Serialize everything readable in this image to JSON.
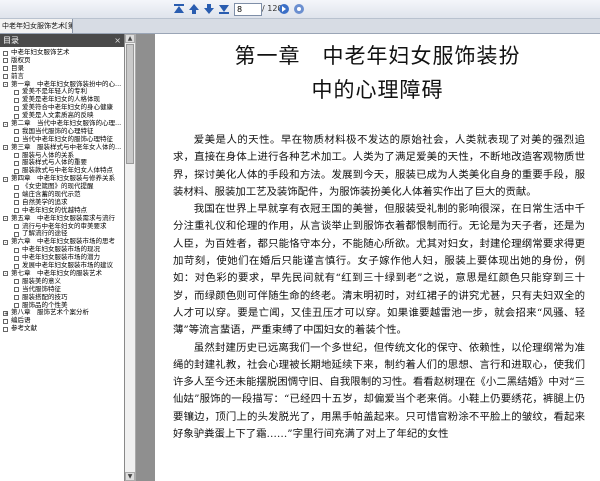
{
  "toolbar": {
    "page_number": "8",
    "page_total": "/ 120"
  },
  "tab": {
    "label": "中老年妇女服饰艺术[第一..."
  },
  "sidebar": {
    "header": "目录",
    "close": "×",
    "items": [
      {
        "label": "中老年妇女服饰艺术",
        "indent": 0
      },
      {
        "label": "版权页",
        "indent": 0
      },
      {
        "label": "目录",
        "indent": 0
      },
      {
        "label": "前言",
        "indent": 0
      },
      {
        "label": "第一章　中老年妇女服饰装扮中的心...",
        "indent": 0,
        "expand": "-"
      },
      {
        "label": "爱美不是年轻人的专利",
        "indent": 1
      },
      {
        "label": "爱美是老年妇女的人格体现",
        "indent": 1
      },
      {
        "label": "爱美符合中老年妇女的身心健康",
        "indent": 1
      },
      {
        "label": "爱美是人文素质高的反映",
        "indent": 1
      },
      {
        "label": "第二章　当代中老年妇女服饰的心理...",
        "indent": 0,
        "expand": "-"
      },
      {
        "label": "我国当代服饰的心理特征",
        "indent": 1
      },
      {
        "label": "当代中老年妇女的服饰心理特征",
        "indent": 1
      },
      {
        "label": "第三章　服装样式与中老年女人体的...",
        "indent": 0,
        "expand": "-"
      },
      {
        "label": "服装与人体的关系",
        "indent": 1
      },
      {
        "label": "服装样式与人体的重要",
        "indent": 1
      },
      {
        "label": "服装款式与中老年妇女人体特点",
        "indent": 1
      },
      {
        "label": "第四章　中老年妇女服装与修养关系",
        "indent": 0,
        "expand": "-"
      },
      {
        "label": "《女史箴图》的现代提醒",
        "indent": 1
      },
      {
        "label": "端庄含蓄的现代示范",
        "indent": 1
      },
      {
        "label": "自然美学的追求",
        "indent": 1
      },
      {
        "label": "中老年妇女的优越特点",
        "indent": 1
      },
      {
        "label": "第五章　中老年妇女服装需求与流行",
        "indent": 0,
        "expand": "-"
      },
      {
        "label": "流行与中老年妇女的审美要求",
        "indent": 1
      },
      {
        "label": "了解流行的途径",
        "indent": 1
      },
      {
        "label": "第六章　中老年妇女服装市场的思考",
        "indent": 0,
        "expand": "-"
      },
      {
        "label": "中老年妇女服装市场的现况",
        "indent": 1
      },
      {
        "label": "中老年妇女服装市场的潜力",
        "indent": 1
      },
      {
        "label": "发展中老年妇女服装市场的建议",
        "indent": 1
      },
      {
        "label": "第七章　中老年妇女的服装艺术",
        "indent": 0,
        "expand": "-"
      },
      {
        "label": "服装美的意义",
        "indent": 1
      },
      {
        "label": "当代服饰特征",
        "indent": 1
      },
      {
        "label": "服装搭配的技巧",
        "indent": 1
      },
      {
        "label": "服饰品的个性美",
        "indent": 1
      },
      {
        "label": "第八章　服饰艺术个案分析",
        "indent": 0,
        "expand": "+"
      },
      {
        "label": "编后语",
        "indent": 0
      },
      {
        "label": "参考文献",
        "indent": 0
      }
    ]
  },
  "document": {
    "title_line1": "第一章　中老年妇女服饰装扮",
    "title_line2": "中的心理障碍",
    "paragraphs": [
      "爱美是人的天性。早在物质材料极不发达的原始社会，人类就表现了对美的强烈追求，直接在身体上进行各种艺术加工。人类为了满足爱美的天性，不断地改造客观物质世界，探讨美化人体的手段和方法。发展到今天，服装已成为人类美化自身的重要手段，服装材料、服装加工艺及装饰配件，为服饰装扮美化人体着实作出了巨大的贡献。",
      "我国在世界上早就享有衣冠王国的美誉，但服装受礼制的影响很深，在日常生活中千分注重礼仪和伦理的作用，从言谈举止到服饰衣着都恨制而行。无论是为天子者，还是为人臣，为百姓者，都只能恪守本分，不能随心所欲。尤其对妇女，封建伦理纲常要求得更加苛刻，使她们在婚后只能谨言慎行。女子嫁作他人妇，服装上要体现出她的身份，例如：对色彩的要求，早先民间就有“红到三十绿到老”之说，意思是红颜色只能穿到三十岁，而绿颜色则可伴随生命的终老。清末明初时，对红裙子的讲究尤甚，只有夫妇双全的人才可以穿。要是亡闻，又佳丑压才可以穿。如果谁要越雷池一步，就会招来“风骚、轻薄”等流言蜚语，严重束缚了中国妇女的着装个性。",
      "虽然封建历史已远离我们一个多世纪，但传统文化的保守、依赖性，以伦理纲常为准绳的封建礼教，社会心理被长期地延续下来，制约着人们的思想、言行和进取心，使我们许多人至今还未能摆脱困惆守旧、自我限制的习性。看看赵树理在《小二黑结婚》中对“三仙姑”服饰的一段描写：“已经四十五岁，却偏爱当个老来俏。小鞋上仍要绣花，裤腿上仍要镶边，顶门上的头发脱光了，用黑手帕盖起来。只可惜官粉涂不平脸上的皱纹，看起来好象驴粪蛋上下了霜……”字里行间充满了对上了年纪的女性"
    ]
  }
}
